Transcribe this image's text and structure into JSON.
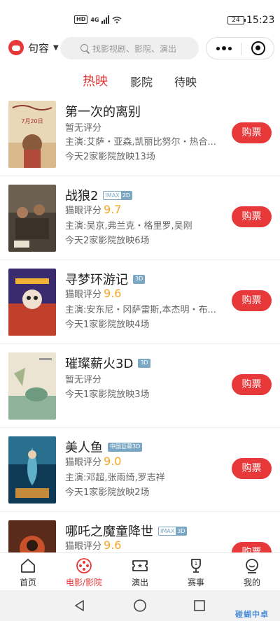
{
  "status_bar": {
    "hd": "HD",
    "network": "4G",
    "battery": "24",
    "time": "15:23"
  },
  "top_bar": {
    "city": "句容",
    "search_placeholder": "找影视剧、影院、演出"
  },
  "tabs": [
    {
      "label": "热映",
      "active": true
    },
    {
      "label": "影院",
      "active": false
    },
    {
      "label": "待映",
      "active": false
    }
  ],
  "movies": [
    {
      "title": "第一次的离别",
      "tag": "",
      "score_label": "暂无评分",
      "score": "",
      "cast": "主演:艾萨・亚森,凯丽比努尔・热合...",
      "showings": "今天2家影院放映13场",
      "buy": "购票",
      "poster_text": "7月20日"
    },
    {
      "title": "战狼2",
      "tag": "IMAX 2D",
      "tag_parts": [
        "IMAX",
        "2D"
      ],
      "score_label": "猫眼评分",
      "score": "9.7",
      "cast": "主演:吴京,弗兰克・格里罗,吴刚",
      "showings": "今天2家影院放映6场",
      "buy": "购票"
    },
    {
      "title": "寻梦环游记",
      "tag": "3D",
      "score_label": "猫眼评分",
      "score": "9.6",
      "cast": "主演:安东尼・冈萨雷斯,本杰明・布...",
      "showings": "今天1家影院放映4场",
      "buy": "购票"
    },
    {
      "title": "璀璨薪火3D",
      "tag": "3D",
      "score_label": "暂无评分",
      "score": "",
      "cast": "",
      "showings": "今天1家影院放映3场",
      "buy": "购票"
    },
    {
      "title": "美人鱼",
      "tag": "中国巨幕3D",
      "score_label": "猫眼评分",
      "score": "9.0",
      "cast": "主演:邓超,张雨绮,罗志祥",
      "showings": "今天1家影院放映2场",
      "buy": "购票"
    },
    {
      "title": "哪吒之魔童降世",
      "tag": "IMAX 3D",
      "tag_parts": [
        "IMAX",
        "3D"
      ],
      "score_label": "猫眼评分",
      "score": "9.6",
      "cast": "",
      "showings": "",
      "buy": "购票"
    }
  ],
  "bottom_nav": [
    {
      "label": "首页",
      "icon": "home-icon",
      "active": false
    },
    {
      "label": "电影/影院",
      "icon": "film-reel-icon",
      "active": true
    },
    {
      "label": "演出",
      "icon": "ticket-icon",
      "active": false
    },
    {
      "label": "赛事",
      "icon": "trophy-icon",
      "active": false
    },
    {
      "label": "我的",
      "icon": "user-icon",
      "active": false
    }
  ],
  "watermark": "碰蝴中卓",
  "colors": {
    "accent": "#e8393a",
    "score": "#f5a623",
    "tag": "#7aa7c3"
  }
}
